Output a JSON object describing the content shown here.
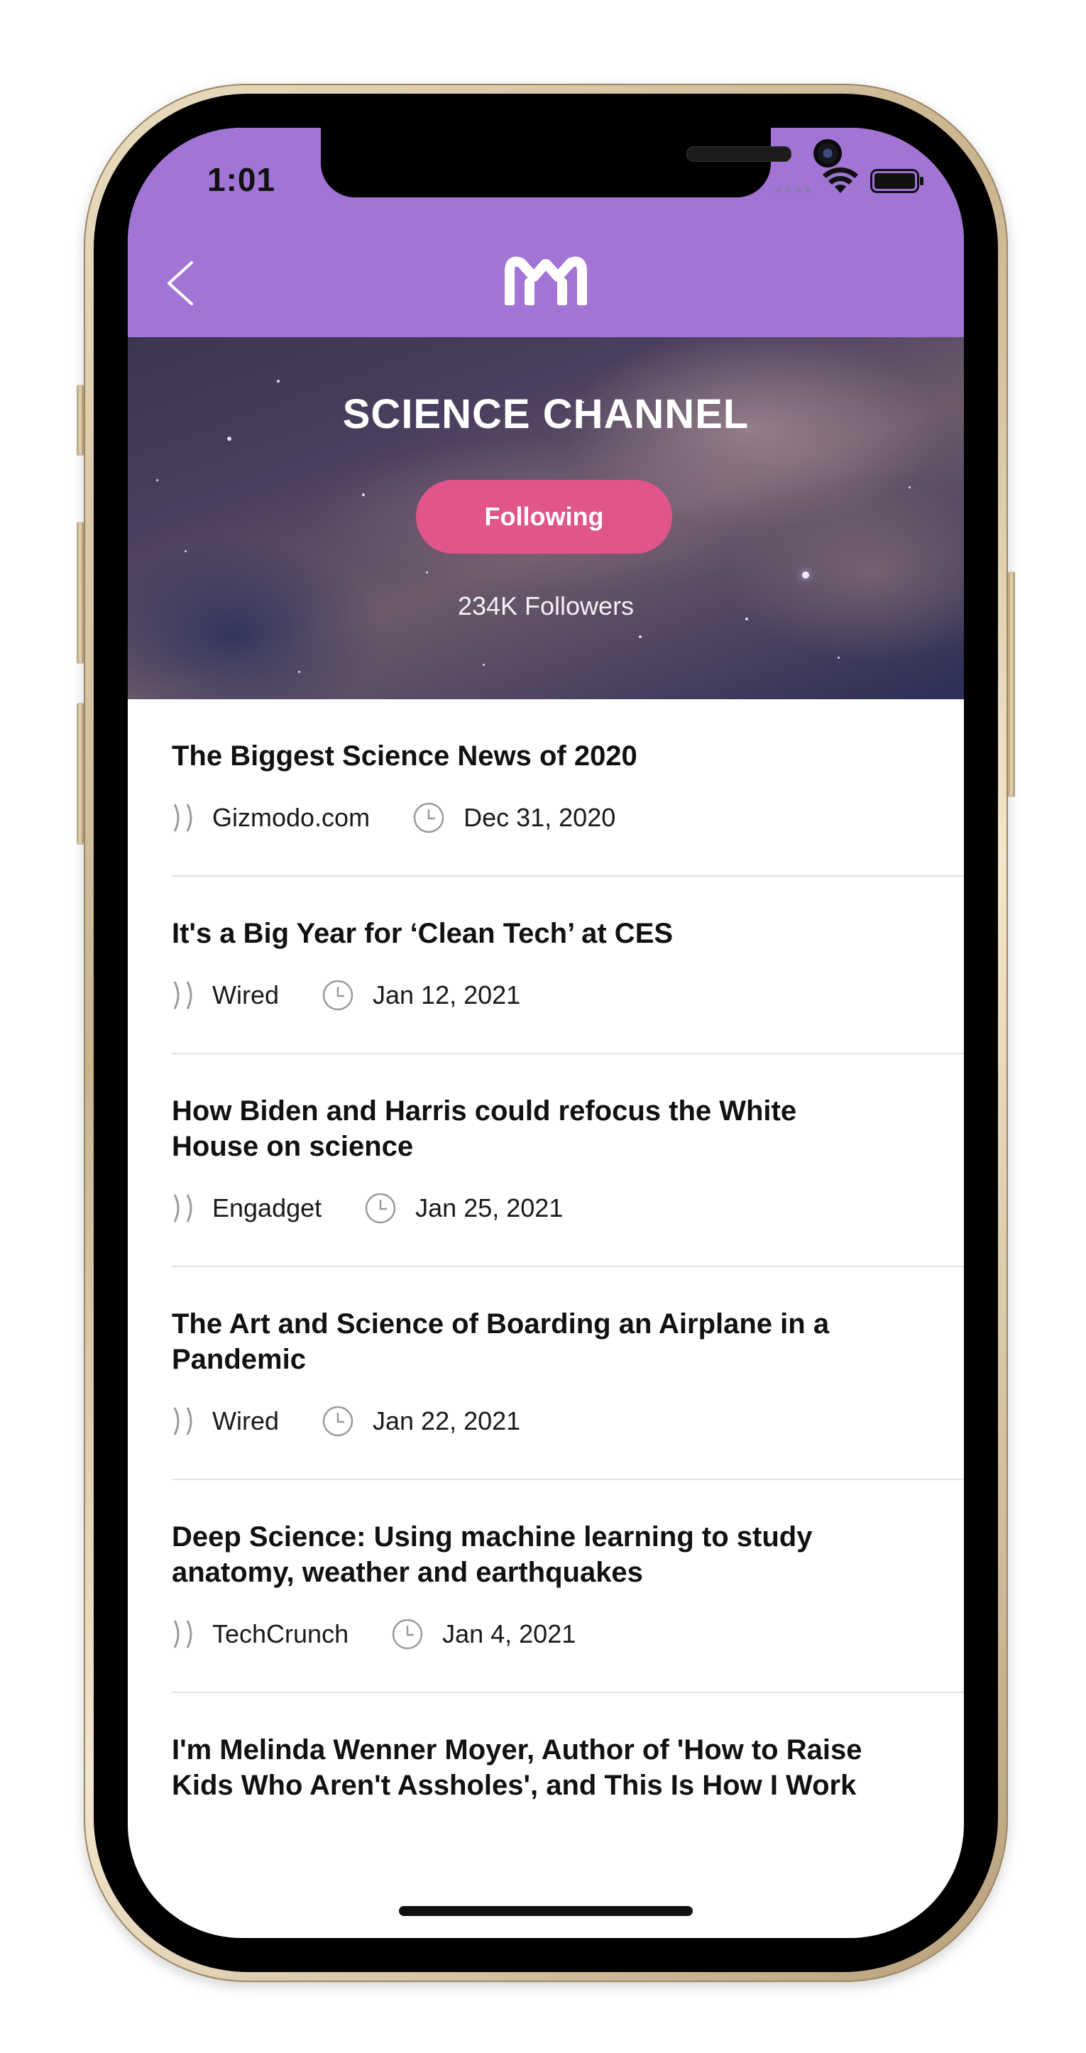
{
  "status_bar": {
    "time": "1:01"
  },
  "header": {
    "back_label": "Back",
    "logo_name": "mm-logo-icon"
  },
  "channel": {
    "title": "SCIENCE CHANNEL",
    "follow_button": "Following",
    "followers": "234K Followers"
  },
  "articles": [
    {
      "title": "The Biggest Science News of 2020",
      "source": "Gizmodo.com",
      "date": "Dec 31, 2020"
    },
    {
      "title": "It's a Big Year for ‘Clean Tech’ at CES",
      "source": "Wired",
      "date": "Jan 12, 2021"
    },
    {
      "title": "How Biden and Harris could refocus the White House on science",
      "source": "Engadget",
      "date": "Jan 25, 2021"
    },
    {
      "title": "The Art and Science of Boarding an Airplane in a Pandemic",
      "source": "Wired",
      "date": "Jan 22, 2021"
    },
    {
      "title": "Deep Science: Using machine learning to study anatomy, weather and earthquakes",
      "source": "TechCrunch",
      "date": "Jan 4, 2021"
    },
    {
      "title": "I'm Melinda Wenner Moyer, Author of 'How to Raise Kids Who Aren't Assholes', and This Is How I Work",
      "source": "",
      "date": ""
    }
  ],
  "colors": {
    "header_purple": "#a174d6",
    "follow_pink": "#e2558b",
    "divider": "#e4e4e4",
    "icon_gray": "#9a9a9a"
  }
}
